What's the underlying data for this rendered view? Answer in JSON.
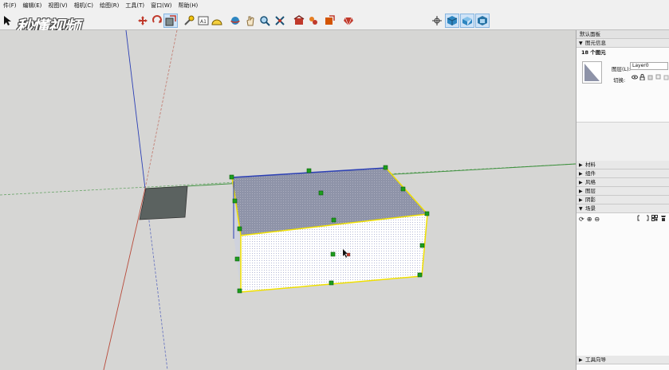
{
  "menu": [
    "件(F)",
    "编辑(E)",
    "视图(V)",
    "相机(C)",
    "绘图(R)",
    "工具(T)",
    "窗口(W)",
    "帮助(H)"
  ],
  "watermark": "秒懂视频",
  "tray": {
    "title": "默认面板",
    "entity_info": {
      "header": "图元信息",
      "count": "18 个图元",
      "layer_label": "图层(L):",
      "layer_value": "Layer0",
      "toggle_label": "切换:"
    },
    "sections": [
      "材料",
      "组件",
      "风格",
      "图层",
      "阴影",
      "场景"
    ],
    "scene_tools": [
      "⟳",
      "⊕",
      "⊖"
    ],
    "bottom_section": "工具向导"
  },
  "colors": {
    "selection": "#f0e000",
    "grip": "#1d9e1d",
    "top_face": "#8e93a8",
    "front_face": "#ffffff",
    "blue_axis": "#2b3fb5",
    "red_axis": "#b84a3a",
    "green_axis": "#3a8f3a"
  }
}
